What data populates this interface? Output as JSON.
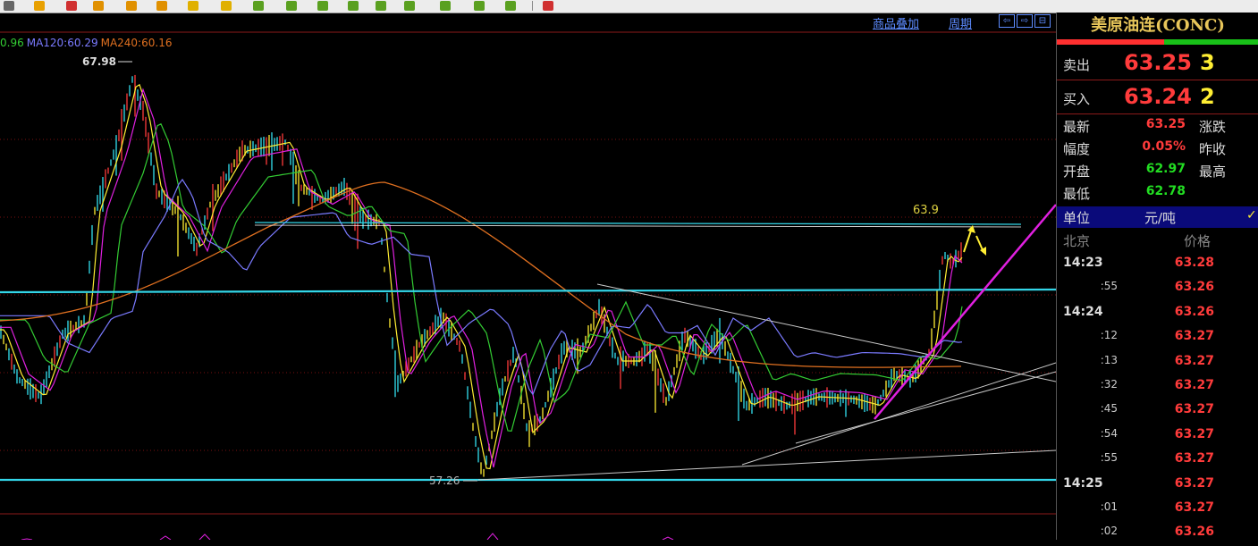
{
  "toolbar": {
    "buttons": [
      {
        "icon": "list-icon",
        "color": "#666666"
      },
      {
        "icon": "bar-chart-icon",
        "color": "#e8a000"
      },
      {
        "icon": "minute-chart-icon",
        "color": "#d03030"
      },
      {
        "icon": "daily-icon",
        "color": "#e09000"
      },
      {
        "icon": "weekly-icon",
        "color": "#e09000"
      },
      {
        "icon": "monthly-icon",
        "color": "#e09000"
      },
      {
        "icon": "quarterly-icon",
        "color": "#e0b000"
      },
      {
        "icon": "yearly-icon",
        "color": "#e0b000"
      },
      {
        "icon": "1min-icon",
        "color": "#5aa020"
      },
      {
        "icon": "3min-icon",
        "color": "#5aa020"
      },
      {
        "icon": "5min-icon",
        "color": "#5aa020"
      },
      {
        "icon": "15min-icon",
        "color": "#5aa020"
      },
      {
        "icon": "30min-icon",
        "color": "#5aa020"
      },
      {
        "icon": "60min-icon",
        "color": "#5aa020"
      },
      {
        "icon": "multi-period-icon",
        "color": "#5aa020"
      },
      {
        "icon": "custom-period-icon",
        "color": "#5aa020"
      },
      {
        "icon": "tick-icon",
        "color": "#5aa020"
      },
      {
        "icon": "close-chart-icon",
        "color": "#d03030"
      }
    ]
  },
  "chart_header": {
    "overlay_link": "商品叠加",
    "period_link": "周期"
  },
  "ma_legend": [
    {
      "text": "0.96",
      "color": "#33cc33"
    },
    {
      "text": "MA120:60.29",
      "color": "#7a7aff"
    },
    {
      "text": "MA240:60.16",
      "color": "#e07020"
    }
  ],
  "annotations": {
    "high_label": "67.98",
    "low_label": "57.26",
    "target_label": "63.9"
  },
  "colors": {
    "grid_red": "#7a1010",
    "support_cyan": "#33d6e8",
    "trend_magenta": "#e020e0",
    "trend_white": "#c8c8c8",
    "arrow_yellow": "#ffee33"
  },
  "quote_panel": {
    "title": "美原油连(CONC)",
    "sell_label": "卖出",
    "sell_price": "63.25",
    "sell_volume": "3",
    "buy_label": "买入",
    "buy_price": "63.24",
    "buy_volume": "2",
    "stats": [
      {
        "label": "最新",
        "value": "63.25",
        "color": "#ff3b3b",
        "label2": "涨跌"
      },
      {
        "label": "幅度",
        "value": "0.05%",
        "color": "#ff3b3b",
        "label2": "昨收"
      },
      {
        "label": "开盘",
        "value": "62.97",
        "color": "#22dd22",
        "label2": "最高"
      },
      {
        "label": "最低",
        "value": "62.78",
        "color": "#22dd22",
        "label2": ""
      }
    ],
    "unit_label": "单位",
    "unit_value": "元/吨",
    "unit_check": "✓",
    "tick_header_left": "北京",
    "tick_header_right": "价格",
    "ticks": [
      {
        "time": "14:23",
        "hour": true,
        "price": "63.28"
      },
      {
        "time": ":55",
        "hour": false,
        "price": "63.26"
      },
      {
        "time": "14:24",
        "hour": true,
        "price": "63.26"
      },
      {
        "time": ":12",
        "hour": false,
        "price": "63.27"
      },
      {
        "time": ":13",
        "hour": false,
        "price": "63.27"
      },
      {
        "time": ":32",
        "hour": false,
        "price": "63.27"
      },
      {
        "time": ":45",
        "hour": false,
        "price": "63.27"
      },
      {
        "time": ":54",
        "hour": false,
        "price": "63.27"
      },
      {
        "time": ":55",
        "hour": false,
        "price": "63.27"
      },
      {
        "time": "14:25",
        "hour": true,
        "price": "63.27"
      },
      {
        "time": ":01",
        "hour": false,
        "price": "63.27"
      },
      {
        "time": ":02",
        "hour": false,
        "price": "63.26"
      }
    ]
  }
}
